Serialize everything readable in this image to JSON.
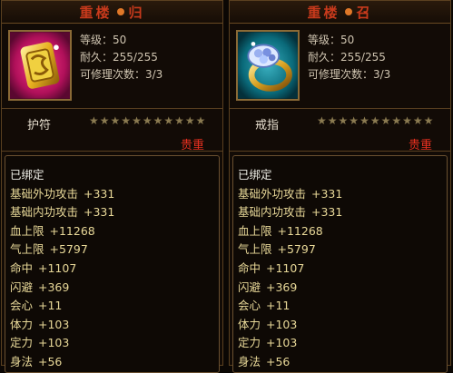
{
  "panels": [
    {
      "title_a": "重楼",
      "title_b": "归",
      "level_label": "等级：50",
      "durability_label": "耐久：255/255",
      "repair_label": "可修理次数：3/3",
      "type": "护符",
      "rarity": "贵重",
      "stars_filled": 0,
      "stars_total": 11,
      "icon": "amulet-icon",
      "bound": "已绑定",
      "attributes": [
        {
          "name": "基础外功攻击",
          "value": "+331"
        },
        {
          "name": "基础内功攻击",
          "value": "+331"
        },
        {
          "name": "血上限",
          "value": "+11268"
        },
        {
          "name": "气上限",
          "value": "+5797"
        },
        {
          "name": "命中",
          "value": "+1107"
        },
        {
          "name": "闪避",
          "value": "+369"
        },
        {
          "name": "会心",
          "value": "+11"
        },
        {
          "name": "体力",
          "value": "+103"
        },
        {
          "name": "定力",
          "value": "+103"
        },
        {
          "name": "身法",
          "value": "+56"
        }
      ]
    },
    {
      "title_a": "重楼",
      "title_b": "召",
      "level_label": "等级：50",
      "durability_label": "耐久：255/255",
      "repair_label": "可修理次数：3/3",
      "type": "戒指",
      "rarity": "贵重",
      "stars_filled": 0,
      "stars_total": 11,
      "icon": "ring-icon",
      "bound": "已绑定",
      "attributes": [
        {
          "name": "基础外功攻击",
          "value": "+331"
        },
        {
          "name": "基础内功攻击",
          "value": "+331"
        },
        {
          "name": "血上限",
          "value": "+11268"
        },
        {
          "name": "气上限",
          "value": "+5797"
        },
        {
          "name": "命中",
          "value": "+1107"
        },
        {
          "name": "闪避",
          "value": "+369"
        },
        {
          "name": "会心",
          "value": "+11"
        },
        {
          "name": "体力",
          "value": "+103"
        },
        {
          "name": "定力",
          "value": "+103"
        },
        {
          "name": "身法",
          "value": "+56"
        }
      ]
    }
  ],
  "colors": {
    "title": "#c83a1c",
    "rarity": "#e83020",
    "attr": "#e8d898"
  }
}
